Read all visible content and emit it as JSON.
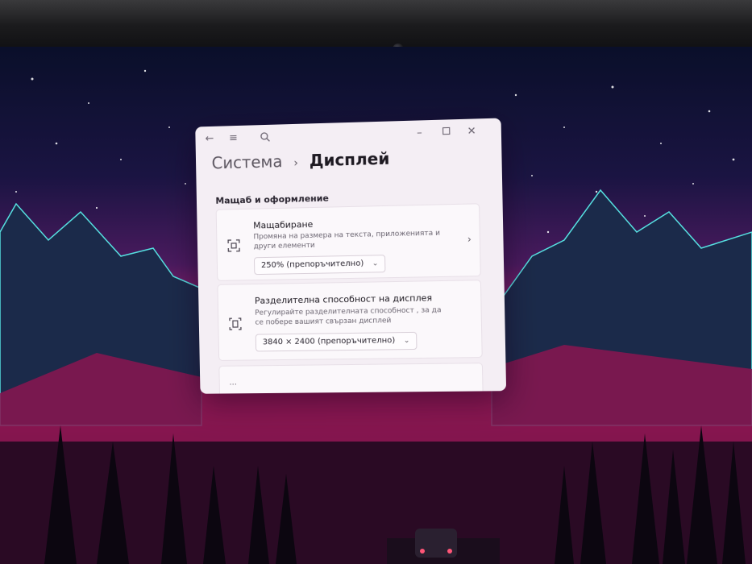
{
  "window": {
    "breadcrumb": {
      "parent": "Система",
      "separator": "›",
      "current": "Дисплей"
    },
    "titlebar_icons": {
      "back": "back-arrow-icon",
      "menu": "hamburger-menu-icon",
      "search": "search-icon",
      "minimize": "minimize-icon",
      "maximize": "maximize-icon",
      "close": "close-icon"
    }
  },
  "section": {
    "title": "Мащаб и оформление"
  },
  "scale": {
    "title": "Мащабиране",
    "description": "Промяна на размера на текста, приложенията и други елементи",
    "value": "250% (препоръчително)",
    "icon": "scale-icon"
  },
  "resolution": {
    "title": "Разделителна способност на дисплея",
    "description": "Регулирайте разделителната способност , за да се побере вашият свързан дисплей",
    "value": "3840 × 2400 (препоръчително)",
    "icon": "resolution-icon"
  },
  "colors": {
    "window_bg": "#f4eef4",
    "card_bg": "#fbf8fb",
    "wallpaper_accent": "#e0307a"
  }
}
